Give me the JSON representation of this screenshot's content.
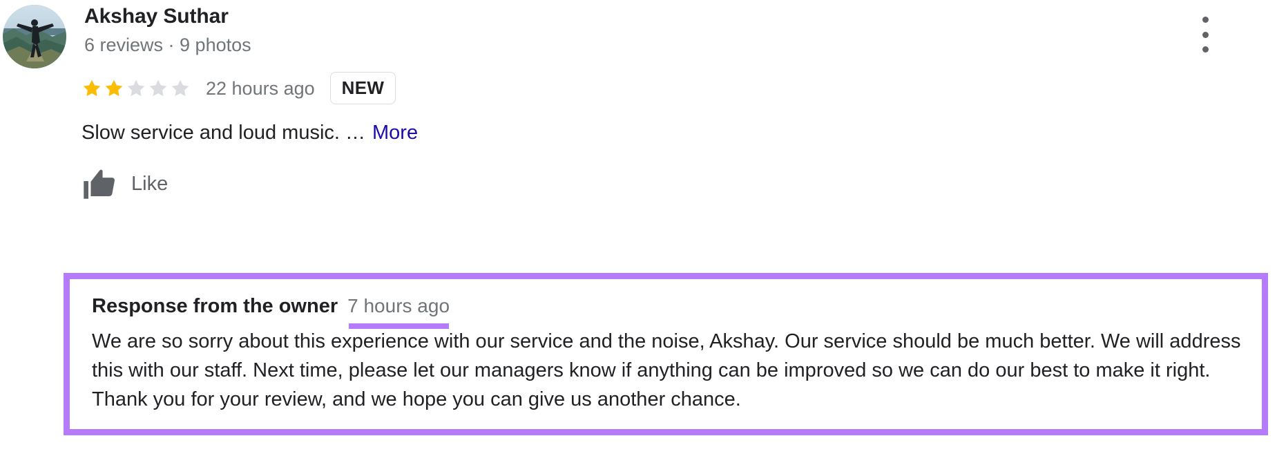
{
  "review": {
    "reviewer_name": "Akshay Suthar",
    "reviewer_meta": "6 reviews · 9 photos",
    "rating": 2,
    "max_rating": 5,
    "age": "22 hours ago",
    "badge": "NEW",
    "text": "Slow service and loud music. …",
    "more_label": "More",
    "like_label": "Like",
    "avatar_alt": "reviewer-profile-photo"
  },
  "owner_response": {
    "title": "Response from the owner",
    "age": "7 hours ago",
    "text": "We are so sorry about this experience with our service and the noise, Akshay. Our service should be much better. We will address this with our staff. Next time, please let our managers know if anything can be improved so we can do our best to make it right. Thank you for your review, and we hope you can give us another chance."
  },
  "icons": {
    "overflow": "more-vert-icon",
    "thumb": "thumb-up-icon",
    "star_filled": "star-filled-icon",
    "star_empty": "star-empty-icon"
  },
  "colors": {
    "star_filled": "#fbbc04",
    "star_empty": "#dadce0",
    "link": "#1a0dab",
    "highlight": "#b47cfa",
    "text_primary": "#202124",
    "text_secondary": "#70757a",
    "icon_gray": "#5f6368"
  }
}
